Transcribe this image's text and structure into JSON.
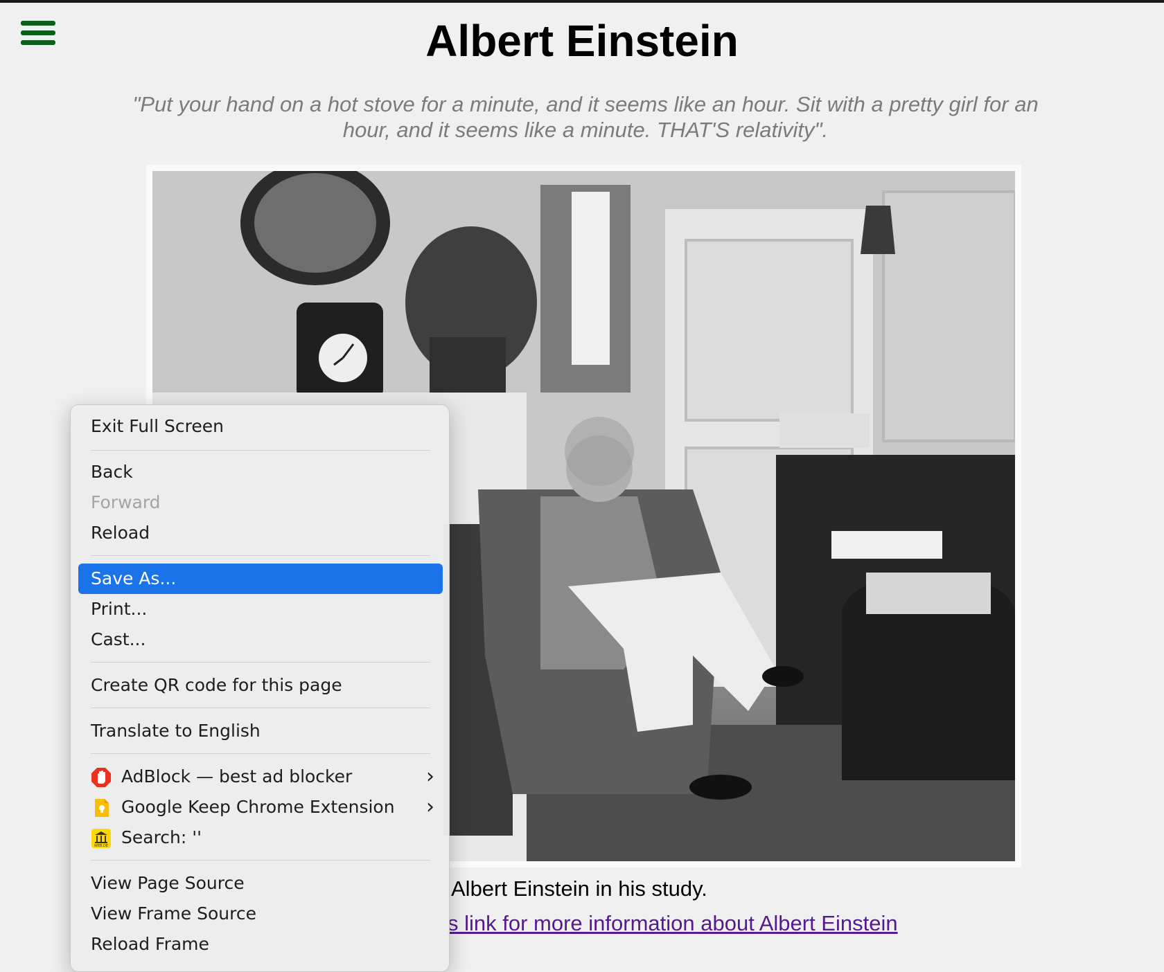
{
  "page": {
    "title": "Albert Einstein",
    "quote": "\"Put your hand on a hot stove for a minute, and it seems like an hour. Sit with a pretty girl for an hour, and it seems like a minute. THAT'S relativity\".",
    "caption": "Albert Einstein in his study.",
    "link_text": "s link for more information about Albert Einstein"
  },
  "context_menu": {
    "exit_full_screen": "Exit Full Screen",
    "back": "Back",
    "forward": "Forward",
    "reload": "Reload",
    "save_as": "Save As...",
    "print": "Print...",
    "cast": "Cast...",
    "create_qr": "Create QR code for this page",
    "translate": "Translate to English",
    "adblock": "AdBlock — best ad blocker",
    "google_keep": "Google Keep Chrome Extension",
    "search": "Search: ''",
    "view_page_source": "View Page Source",
    "view_frame_source": "View Frame Source",
    "reload_frame": "Reload Frame",
    "webde_icon_text": "WEB.DE"
  },
  "colors": {
    "hamburger": "#0b5e1c",
    "highlight": "#1a73e8",
    "link": "#551a8b"
  }
}
